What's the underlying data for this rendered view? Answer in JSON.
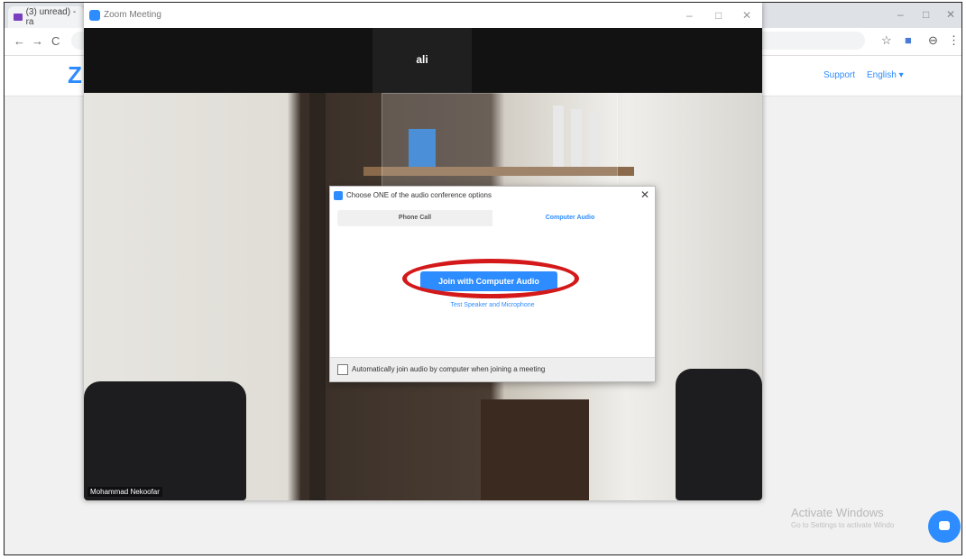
{
  "browser": {
    "tab_title": "(3) unread) - ra",
    "back_glyph": "←",
    "forward_glyph": "→",
    "reload_glyph": "C",
    "minimize_glyph": "–",
    "restore_glyph": "□",
    "close_glyph": "✕",
    "star_glyph": "☆",
    "profile_glyph": "⊖",
    "menu_glyph": "⋮"
  },
  "site_header": {
    "logo_text": "Z",
    "support_label": "Support",
    "language_label": "English ▾"
  },
  "zoom_window": {
    "title": "Zoom Meeting",
    "minimize_glyph": "–",
    "restore_glyph": "□",
    "close_glyph": "✕",
    "participant_name": "ali",
    "self_name": "Mohammad Nekoofar"
  },
  "audio_dialog": {
    "title": "Choose ONE of the audio conference options",
    "close_glyph": "✕",
    "tabs": [
      {
        "label": "Phone Call",
        "active": false
      },
      {
        "label": "Computer Audio",
        "active": true
      }
    ],
    "join_button_label": "Join with Computer Audio",
    "test_link_label": "Test Speaker and Microphone",
    "auto_join_label": "Automatically join audio by computer when joining a meeting",
    "auto_join_checked": false,
    "highlight_color": "#d31919"
  },
  "watermark": {
    "line1": "Activate Windows",
    "line2": "Go to Settings to activate Windo"
  },
  "colors": {
    "accent": "#2d8cff",
    "annotation": "#d31919"
  }
}
